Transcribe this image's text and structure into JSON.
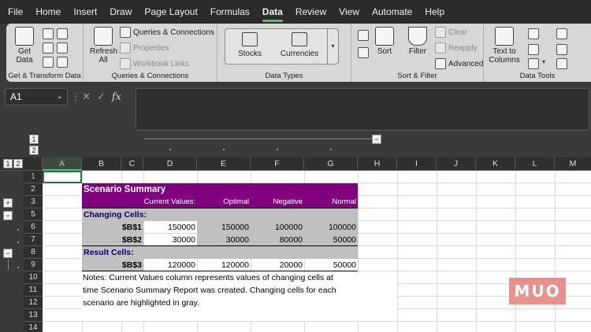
{
  "menu": [
    "File",
    "Home",
    "Insert",
    "Draw",
    "Page Layout",
    "Formulas",
    "Data",
    "Review",
    "View",
    "Automate",
    "Help"
  ],
  "active_menu": "Data",
  "ribbon": {
    "get_transform": {
      "get_data_1": "Get",
      "get_data_2": "Data",
      "label": "Get & Transform Data"
    },
    "queries": {
      "refresh_1": "Refresh",
      "refresh_2": "All",
      "queries_connections": "Queries & Connections",
      "properties": "Properties",
      "workbook_links": "Workbook Links",
      "label": "Queries & Connections"
    },
    "data_types": {
      "stocks": "Stocks",
      "currencies": "Currencies",
      "label": "Data Types"
    },
    "sort_filter": {
      "sort": "Sort",
      "filter": "Filter",
      "clear": "Clear",
      "reapply": "Reapply",
      "advanced": "Advanced",
      "label": "Sort & Filter"
    },
    "data_tools": {
      "text_to_columns_1": "Text to",
      "text_to_columns_2": "Columns",
      "label": "Data Tools"
    }
  },
  "formula_bar": {
    "name_box": "A1",
    "fx": "fx",
    "cancel": "✕",
    "enter": "✓"
  },
  "outline": {
    "col_levels": [
      "1",
      "2"
    ],
    "row_levels": [
      "1",
      "2"
    ],
    "collapse": "−",
    "expand": "+"
  },
  "columns": [
    "A",
    "B",
    "C",
    "D",
    "E",
    "F",
    "G",
    "H",
    "I",
    "J",
    "K",
    "L",
    "M"
  ],
  "rows": [
    "1",
    "2",
    "3",
    "5",
    "6",
    "7",
    "8",
    "9",
    "10",
    "11",
    "12",
    "13",
    "14"
  ],
  "sheet": {
    "title": "Scenario Summary",
    "col_headers": [
      "Current Values:",
      "Optimal",
      "Negative",
      "Normal"
    ],
    "changing_cells_label": "Changing Cells:",
    "result_cells_label": "Result Cells:",
    "rows": [
      {
        "ref": "$B$1",
        "values": [
          "150000",
          "150000",
          "100000",
          "100000"
        ]
      },
      {
        "ref": "$B$2",
        "values": [
          "30000",
          "30000",
          "80000",
          "50000"
        ]
      }
    ],
    "result": {
      "ref": "$B$3",
      "values": [
        "120000",
        "120000",
        "20000",
        "50000"
      ]
    },
    "notes_1": "Notes:  Current Values column represents values of changing cells at",
    "notes_2": "time Scenario Summary Report was created.  Changing cells for each",
    "notes_3": "scenario are highlighted in gray."
  },
  "colors": {
    "header_purple": "#800080",
    "gray_fill": "#c0c0c0",
    "label_navy": "#000080",
    "accent_green": "#5fb875"
  },
  "watermark": "MUO"
}
